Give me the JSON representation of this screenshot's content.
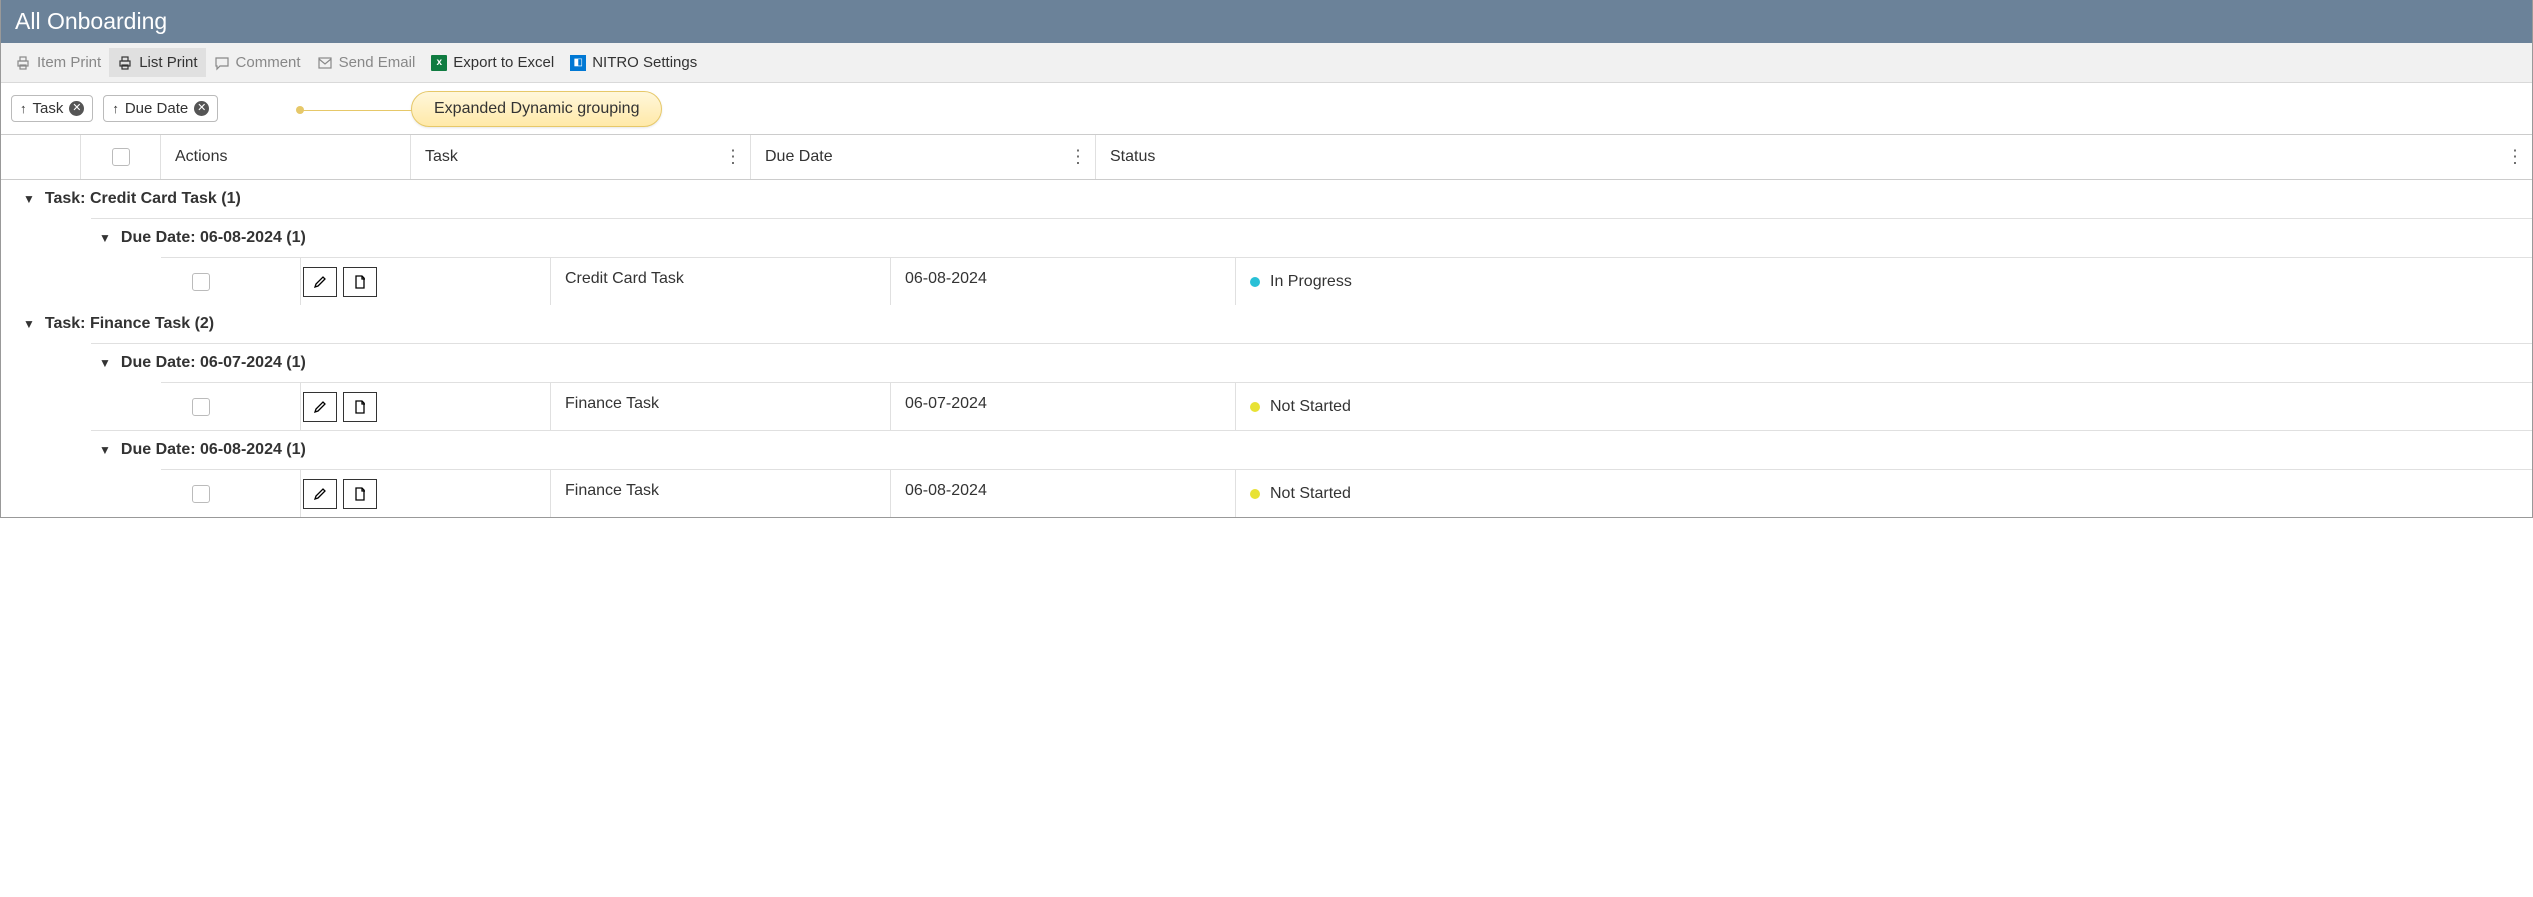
{
  "header": {
    "title": "All Onboarding"
  },
  "toolbar": {
    "item_print": "Item Print",
    "list_print": "List Print",
    "comment": "Comment",
    "send_email": "Send Email",
    "export_excel": "Export to Excel",
    "nitro_settings": "NITRO Settings"
  },
  "filters": {
    "chips": [
      {
        "label": "Task",
        "direction": "↑"
      },
      {
        "label": "Due Date",
        "direction": "↑"
      }
    ],
    "callout": "Expanded Dynamic grouping"
  },
  "columns": {
    "actions": "Actions",
    "task": "Task",
    "due_date": "Due Date",
    "status": "Status"
  },
  "status_colors": {
    "In Progress": "#29c0d6",
    "Not Started": "#e8e234"
  },
  "groups": [
    {
      "label": "Task: Credit Card Task (1)",
      "subgroups": [
        {
          "label": "Due Date: 06-08-2024 (1)",
          "rows": [
            {
              "task": "Credit Card Task",
              "due": "06-08-2024",
              "status": "In Progress"
            }
          ]
        }
      ]
    },
    {
      "label": "Task: Finance Task (2)",
      "subgroups": [
        {
          "label": "Due Date: 06-07-2024 (1)",
          "rows": [
            {
              "task": "Finance Task",
              "due": "06-07-2024",
              "status": "Not Started"
            }
          ]
        },
        {
          "label": "Due Date: 06-08-2024 (1)",
          "rows": [
            {
              "task": "Finance Task",
              "due": "06-08-2024",
              "status": "Not Started"
            }
          ]
        }
      ]
    }
  ]
}
